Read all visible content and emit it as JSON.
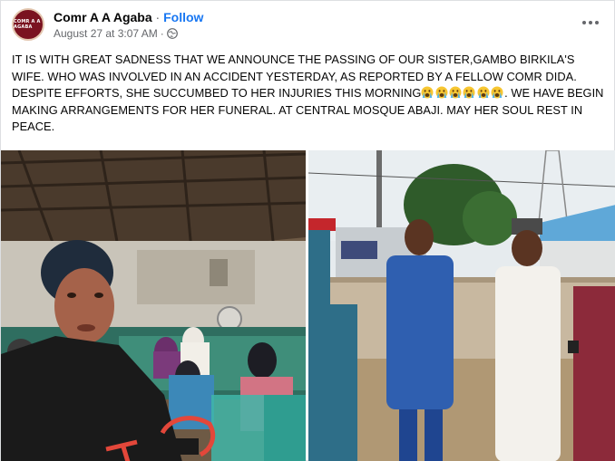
{
  "post": {
    "author": "Comr A A Agaba",
    "separator": "·",
    "follow_label": "Follow",
    "timestamp": "August 27 at 3:07 AM",
    "meta_separator": "·",
    "privacy_icon": "globe-icon",
    "more_icon": "more-options-icon",
    "avatar_text": "COMR A A AGABA",
    "text_before": "IT IS WITH GREAT SADNESS THAT WE ANNOUNCE THE PASSING OF OUR SISTER,GAMBO BIRKILA'S WIFE. WHO WAS INVOLVED IN AN ACCIDENT YESTERDAY, AS REPORTED BY A FELLOW COMR DIDA. DESPITE EFFORTS, SHE SUCCUMBED TO HER INJURIES THIS MORNING",
    "emoji_icon": "crying-face-emoji-icon",
    "emoji_count": 6,
    "text_after": ". WE HAVE BEGIN MAKING ARRANGEMENTS FOR HER FUNERAL. AT CENTRAL MOSQUE ABAJI. MAY HER SOUL REST IN PEACE.",
    "photos": [
      "photo-woman-in-hall",
      "photo-men-outdoors"
    ]
  },
  "colors": {
    "accent": "#1877f2",
    "meta_text": "#65676b",
    "text": "#050505",
    "avatar_bg": "#7a1220"
  }
}
